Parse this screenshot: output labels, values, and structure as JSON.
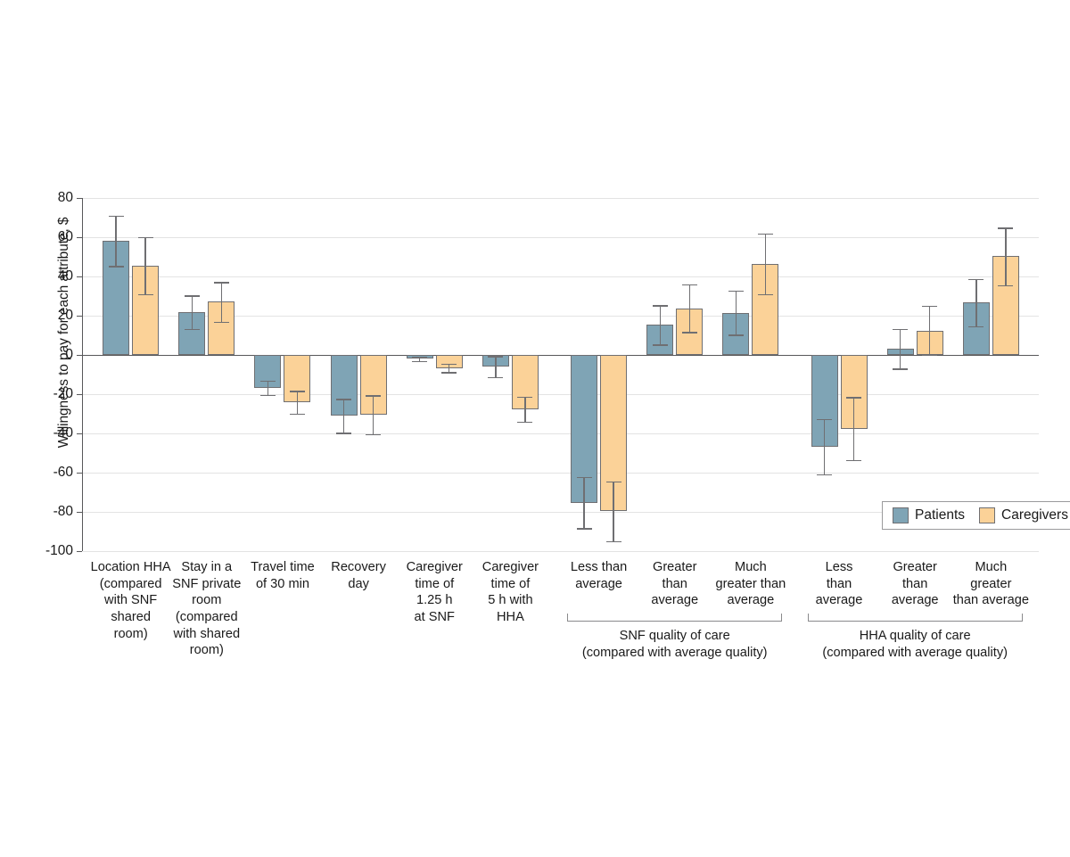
{
  "chart_data": {
    "type": "bar",
    "title": "",
    "xlabel": "",
    "ylabel": "Willingness to pay for each attribute, $",
    "ylim": [
      -100,
      80
    ],
    "yticks": [
      80,
      60,
      40,
      20,
      0,
      -20,
      -40,
      -60,
      -80,
      -100
    ],
    "ytick_labels": [
      "80",
      "60",
      "40",
      "20",
      "0",
      "-20",
      "-40",
      "-60",
      "-80",
      "-100"
    ],
    "grid": true,
    "legend_position": "lower-right",
    "legend": [
      "Patients",
      "Caregivers"
    ],
    "colors": {
      "patients": "#7fa4b5",
      "caregivers": "#fbd298",
      "bar_outline": "#6f6f72",
      "gridline": "#e3e3e3",
      "axis": "#58585a"
    },
    "categories": [
      "Location HHA (compared with SNF shared room)",
      "Stay in a SNF private room (compared with shared room)",
      "Travel time of 30 min",
      "Recovery day",
      "Caregiver time of 1.25 h at SNF",
      "Caregiver time of 5 h with HHA",
      "Less than average",
      "Greater than average",
      "Much greater than average",
      "Less than average",
      "Greater than average",
      "Much greater than average"
    ],
    "category_label_lines": [
      [
        "Location HHA",
        "(compared",
        "with SNF",
        "shared",
        "room)"
      ],
      [
        "Stay in a",
        "SNF private",
        "room",
        "(compared",
        "with shared",
        "room)"
      ],
      [
        "Travel time",
        "of 30 min"
      ],
      [
        "Recovery",
        "day"
      ],
      [
        "Caregiver",
        "time of",
        "1.25 h",
        "at SNF"
      ],
      [
        "Caregiver",
        "time of",
        "5 h with",
        "HHA"
      ],
      [
        "Less than",
        "average"
      ],
      [
        "Greater",
        "than",
        "average"
      ],
      [
        "Much",
        "greater than",
        "average"
      ],
      [
        "Less",
        "than",
        "average"
      ],
      [
        "Greater",
        "than",
        "average"
      ],
      [
        "Much",
        "greater",
        "than average"
      ]
    ],
    "series": [
      {
        "name": "Patients",
        "values": [
          58.2,
          21.8,
          -16.8,
          -31.0,
          -2.0,
          -5.8,
          -75.3,
          15.3,
          21.5,
          -46.6,
          3.0,
          26.6
        ],
        "ci_lower": [
          45.4,
          13.3,
          -20.4,
          -39.7,
          -3.2,
          -11.4,
          -88.3,
          5.4,
          10.4,
          -60.8,
          -7.0,
          14.5
        ],
        "ci_upper": [
          71.0,
          30.4,
          -13.0,
          -22.4,
          -0.8,
          -0.6,
          -62.2,
          25.4,
          32.9,
          -32.5,
          13.2,
          38.8
        ]
      },
      {
        "name": "Caregivers",
        "values": [
          45.4,
          27.1,
          -24.1,
          -30.5,
          -6.6,
          -27.6,
          -79.4,
          23.8,
          46.5,
          -37.5,
          12.5,
          50.3
        ],
        "ci_lower": [
          31.1,
          17.0,
          -29.9,
          -40.5,
          -8.7,
          -34.0,
          -95.0,
          11.6,
          31.1,
          -53.5,
          0.0,
          35.5
        ],
        "ci_upper": [
          60.0,
          37.1,
          -18.3,
          -20.6,
          -4.5,
          -21.2,
          -64.5,
          36.0,
          61.9,
          -21.5,
          25.1,
          64.8
        ]
      }
    ],
    "group_brackets": [
      {
        "label_lines": [
          "SNF quality of care",
          "(compared with average quality)"
        ],
        "spans_categories": [
          6,
          7,
          8
        ]
      },
      {
        "label_lines": [
          "HHA quality of care",
          "(compared with average quality)"
        ],
        "spans_categories": [
          9,
          10,
          11
        ]
      }
    ]
  }
}
